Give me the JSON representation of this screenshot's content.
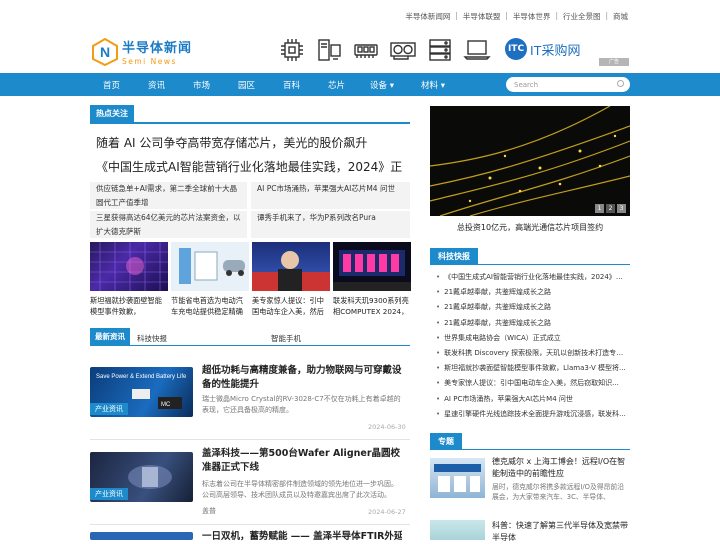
{
  "toplinks": [
    "半导体新闻网",
    "半导体联盟",
    "半导体世界",
    "行业全景图",
    "商城"
  ],
  "logo": {
    "cn": "半导体新闻",
    "en": "Semi News",
    "mark": "N"
  },
  "header": {
    "it_logo_text": "IT采购网",
    "it_logo_mark": "ITC",
    "ad_tag": "广告 "
  },
  "header_icons": [
    "chip-icon",
    "server-tower-icon",
    "memory-module-icon",
    "graphics-card-icon",
    "server-rack-icon",
    "laptop-icon"
  ],
  "nav": {
    "items": [
      "首页",
      "资讯",
      "市场",
      "园区",
      "百科",
      "芯片",
      "设备 ▾",
      "材料 ▾"
    ],
    "search_placeholder": "Search"
  },
  "hot": {
    "title": "热点关注",
    "headline1": "随着 AI 公司争夺高带宽存储芯片，美光的股价飙升",
    "headline2": "《中国生成式AI智能营销行业化落地最佳实践，2024》正",
    "grid": [
      "供应链急单+AI需求，第二季全球前十大晶圆代工产值季增",
      "AI PC市场涌热，苹果强大AI芯片M4 问世",
      "三星获得高达64亿美元的芯片法案资金，以扩大德克萨斯",
      "谭秀手机来了，华为P系列改名Pura"
    ],
    "thumbs": [
      "斯坦福就抄袭面壁智能模型事件致歉，Llama3-V",
      "节能省电首选为电动汽车充电站提供稳定精确的时",
      "美专家惊人提议：引中国电动车企入美，然后窃",
      "联发科天玑9300系列亮相COMPUTEX 2024，"
    ]
  },
  "latest": {
    "tabs": [
      "最新资讯",
      "科技快报",
      "智能手机"
    ],
    "articles": [
      {
        "title": "超低功耗与高精度兼备，助力物联网与可穿戴设备的性能提升",
        "summary": "瑞士微晶Micro Crystal的RV-3028-C7不仅在功耗上有着卓越的表现，它还具备极高的精度。",
        "badge": "产业资讯",
        "date": "2024-06-30",
        "img_text": "Save Power & Extend Battery Life"
      },
      {
        "title": "盖泽科技——第500台Wafer Aligner晶圆校准器正式下线",
        "summary": "标志着公司在半导体精密部件制造领域的领先地位进一步巩固。公司高层领导、技术团队成员以及特邀嘉宾出席了此次活动。",
        "badge": "产业资讯",
        "date": "2024-06-27",
        "source": "盖普"
      },
      {
        "title": "一日双机，蓄势赋能 —— 盖泽半导体FTIR外延膜厚测量"
      }
    ]
  },
  "banner": {
    "caption": "总投资10亿元，高端光通信芯片项目签约",
    "pager": [
      "1",
      "2",
      "3"
    ]
  },
  "tech": {
    "title": "科技快报",
    "items": [
      "《中国生成式AI智能营销行业化落地最佳实践，2024》正...",
      "21戴卓越奉献，共鉴辉煌成长之路",
      "21戴卓越奉献，共鉴辉煌成长之路",
      "21戴卓越奉献，共鉴辉煌成长之路",
      "世界集成电路协会（WICA）正式成立",
      "联发科携 Discovery 探索极限，天玑以创新技术打造专业...",
      "斯坦福就抄袭面壁智能模型事件致歉，Llama3-V 模型将...",
      "美专家惊人提议：引中国电动车企入美，然后窃取知识...",
      "AI PC市场涌热，苹果强大AI芯片M4 问世",
      "星速引擎硬件光线追踪技术全面提升游戏沉浸感，联发科..."
    ]
  },
  "special": {
    "title": "专题",
    "items": [
      {
        "title": "德克威尔 x 上海工博会！远程I/O在智能制造中的前瞻性应",
        "summary": "届时，德克威尔将携多款远程I/O及得昂前沿展会，为大家带来汽车、3C、半导体、"
      },
      {
        "title": "科普：快速了解第三代半导体及宽禁带半导体"
      }
    ]
  }
}
